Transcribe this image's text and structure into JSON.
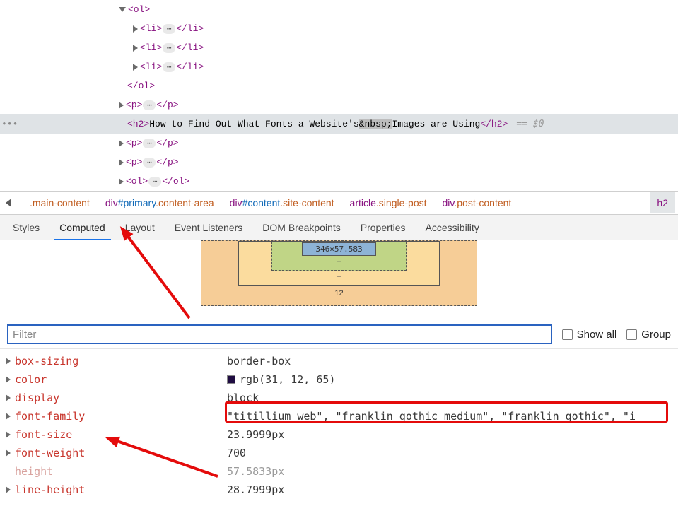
{
  "dom": {
    "rows": [
      {
        "ind": 168,
        "disc": "open",
        "pre": "<ol>",
        "post": "",
        "ell": false
      },
      {
        "ind": 188,
        "disc": "closed",
        "pre": "<li>",
        "post": "</li>",
        "ell": true
      },
      {
        "ind": 188,
        "disc": "closed",
        "pre": "<li>",
        "post": "</li>",
        "ell": true
      },
      {
        "ind": 188,
        "disc": "closed",
        "pre": "<li>",
        "post": "</li>",
        "ell": true
      },
      {
        "ind": 180,
        "disc": "none",
        "pre": "</ol>",
        "post": "",
        "ell": false
      },
      {
        "ind": 168,
        "disc": "closed",
        "pre": "<p>",
        "post": "</p>",
        "ell": true
      },
      {
        "ind": 180,
        "disc": "none",
        "selected": true,
        "gutterdots": true,
        "parts": [
          {
            "t": "tag",
            "v": "<h2>"
          },
          {
            "t": "txt",
            "v": "How to Find Out What Fonts a Website's"
          },
          {
            "t": "nbsp",
            "v": "&nbsp;"
          },
          {
            "t": "txt",
            "v": "Images are Using"
          },
          {
            "t": "tag",
            "v": "</h2>"
          }
        ],
        "suffix": "== $0"
      },
      {
        "ind": 168,
        "disc": "closed",
        "pre": "<p>",
        "post": "</p>",
        "ell": true
      },
      {
        "ind": 168,
        "disc": "closed",
        "pre": "<p>",
        "post": "</p>",
        "ell": true
      },
      {
        "ind": 168,
        "disc": "closed",
        "pre": "<ol>",
        "post": "</ol>",
        "ell": true
      }
    ]
  },
  "breadcrumb": [
    [
      {
        "t": "cls",
        "v": ".main-content"
      }
    ],
    [
      {
        "t": "el",
        "v": "div"
      },
      {
        "t": "id",
        "v": "#primary"
      },
      {
        "t": "cls",
        "v": ".content-area"
      }
    ],
    [
      {
        "t": "el",
        "v": "div"
      },
      {
        "t": "id",
        "v": "#content"
      },
      {
        "t": "cls",
        "v": ".site-content"
      }
    ],
    [
      {
        "t": "el",
        "v": "article"
      },
      {
        "t": "cls",
        "v": ".single-post"
      }
    ],
    [
      {
        "t": "el",
        "v": "div"
      },
      {
        "t": "cls",
        "v": ".post-content"
      }
    ],
    [
      {
        "t": "el",
        "v": "h2"
      }
    ]
  ],
  "tabs": [
    "Styles",
    "Computed",
    "Layout",
    "Event Listeners",
    "DOM Breakpoints",
    "Properties",
    "Accessibility"
  ],
  "active_tab": "Computed",
  "boxmodel": {
    "content": "346×57.583",
    "margin_bottom": "12"
  },
  "filter": {
    "placeholder": "Filter",
    "showall": "Show all",
    "group": "Group"
  },
  "computed": [
    {
      "prop": "box-sizing",
      "val": "border-box"
    },
    {
      "prop": "color",
      "val": "rgb(31, 12, 65)",
      "swatch": true
    },
    {
      "prop": "display",
      "val": "block"
    },
    {
      "prop": "font-family",
      "val": "\"titillium web\", \"franklin gothic medium\", \"franklin gothic\", \"i",
      "hl": true
    },
    {
      "prop": "font-size",
      "val": "23.9999px"
    },
    {
      "prop": "font-weight",
      "val": "700"
    },
    {
      "prop": "height",
      "val": "57.5833px",
      "muted": true,
      "noexp": true
    },
    {
      "prop": "line-height",
      "val": "28.7999px"
    }
  ]
}
